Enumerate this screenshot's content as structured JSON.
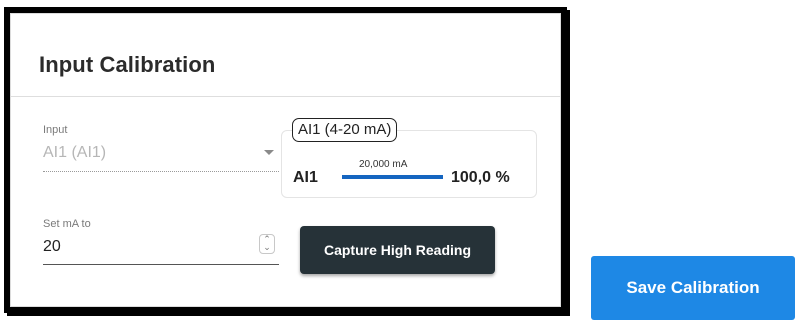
{
  "panel": {
    "title": "Input Calibration"
  },
  "input_select": {
    "label": "Input",
    "value": "AI1 (AI1)"
  },
  "ai_display": {
    "chip_label": "AI1 (4-20 mA)",
    "name": "AI1",
    "ma_value": "20,000 mA",
    "percent": "100,0 %",
    "bar_color": "#1565c0"
  },
  "set_ma": {
    "label": "Set mA to",
    "value": "20"
  },
  "buttons": {
    "capture": "Capture High Reading",
    "save": "Save Calibration"
  },
  "colors": {
    "capture_bg": "#263238",
    "save_bg": "#1e88e5"
  }
}
